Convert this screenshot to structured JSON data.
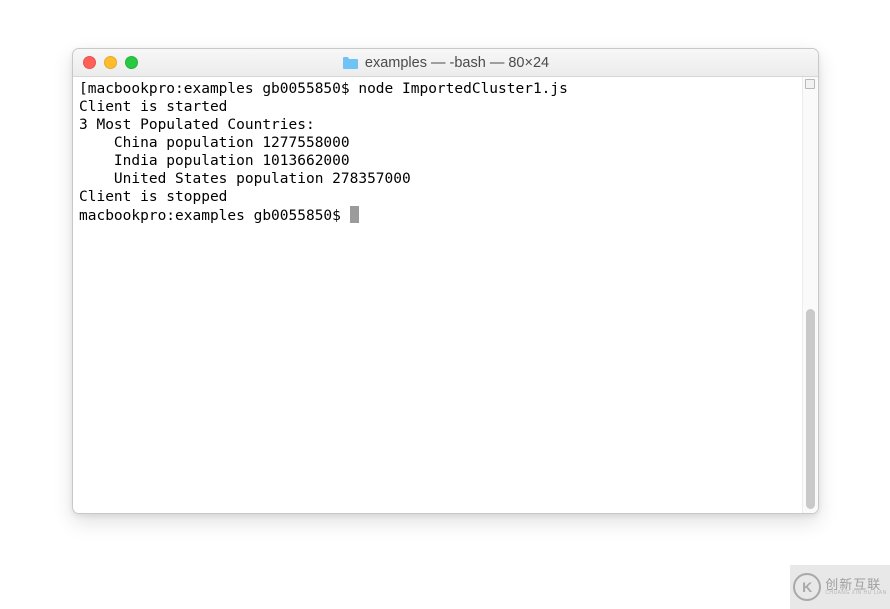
{
  "window": {
    "title": "examples — -bash — 80×24",
    "folder_icon": "folder-icon"
  },
  "terminal": {
    "lines": [
      "[macbookpro:examples gb0055850$ node ImportedCluster1.js",
      "Client is started",
      "3 Most Populated Countries:",
      "    China population 1277558000",
      "    India population 1013662000",
      "    United States population 278357000",
      "Client is stopped"
    ],
    "prompt": "macbookpro:examples gb0055850$ "
  },
  "watermark": {
    "symbol": "K",
    "main": "创新互联",
    "sub": "CHUANG XIN HU LIAN"
  }
}
